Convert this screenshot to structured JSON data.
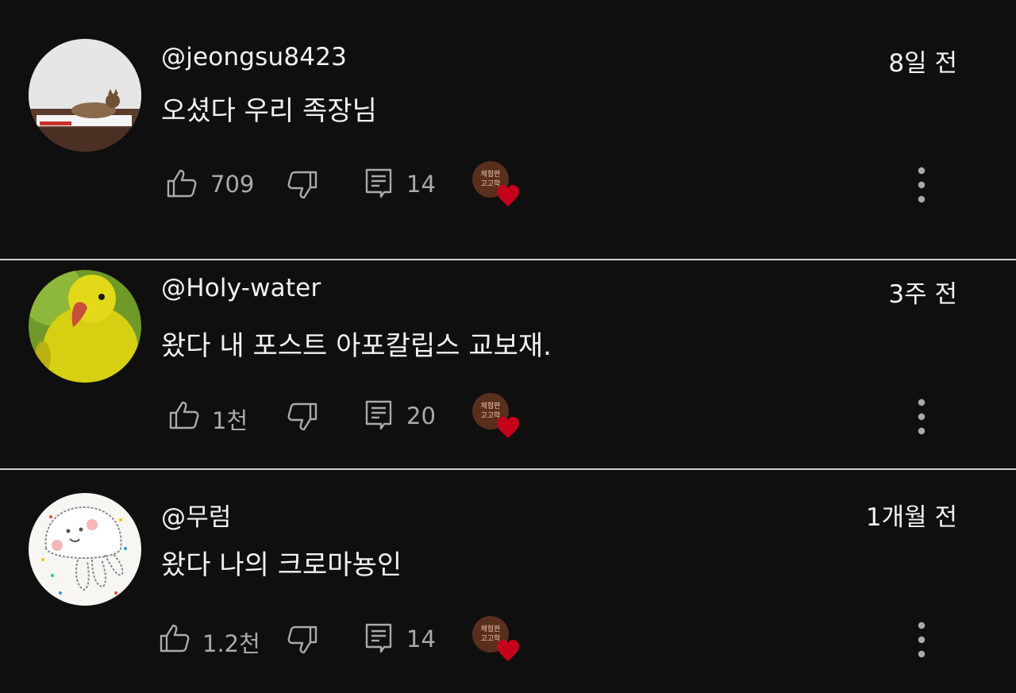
{
  "comments": [
    {
      "author": "@jeongsu8423",
      "time": "8일 전",
      "text": "오셨다 우리 족장님",
      "likes": "709",
      "replies": "14",
      "avatar": "cat-photo-avatar"
    },
    {
      "author": "@Holy-water",
      "time": "3주 전",
      "text": "왔다 내 포스트 아포칼립스 교보재.",
      "likes": "1천",
      "replies": "20",
      "avatar": "yellow-parakeet-avatar"
    },
    {
      "author": "@무럼",
      "time": "1개월 전",
      "text": "왔다 나의 크로마뇽인",
      "likes": "1.2천",
      "replies": "14",
      "avatar": "jellyfish-drawing-avatar"
    }
  ],
  "creator_badge_text": "체험판 고고학",
  "colors": {
    "background": "#0f0f0f",
    "text": "#f1f1f1",
    "muted": "#aaaaaa",
    "heart": "#c4001a"
  }
}
